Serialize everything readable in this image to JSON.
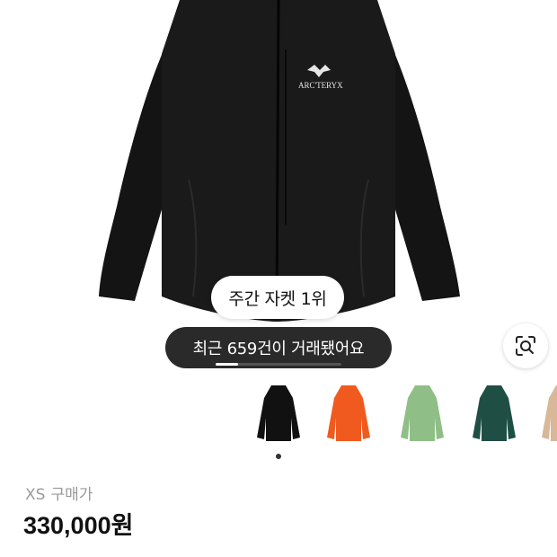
{
  "product": {
    "brand_logo_text": "ARC'TERYX",
    "rank_badge": "주간 자켓 1위",
    "recent_trades": "최근 659건이 거래됐어요",
    "image_index_progress": 0.18
  },
  "variants": [
    {
      "color": "#111111",
      "name": "black-jacket"
    },
    {
      "color": "#f05a1e",
      "name": "orange-jacket"
    },
    {
      "color": "#8fbf86",
      "name": "sage-jacket"
    },
    {
      "color": "#1f4e45",
      "name": "dark-green-jacket"
    },
    {
      "color": "#d8b898",
      "name": "beige-jacket"
    }
  ],
  "selected_variant_index": 0,
  "size_info": {
    "size": "XS",
    "label": "구매가"
  },
  "price": "330,000원",
  "icons": {
    "lens": "lens-search-icon"
  }
}
